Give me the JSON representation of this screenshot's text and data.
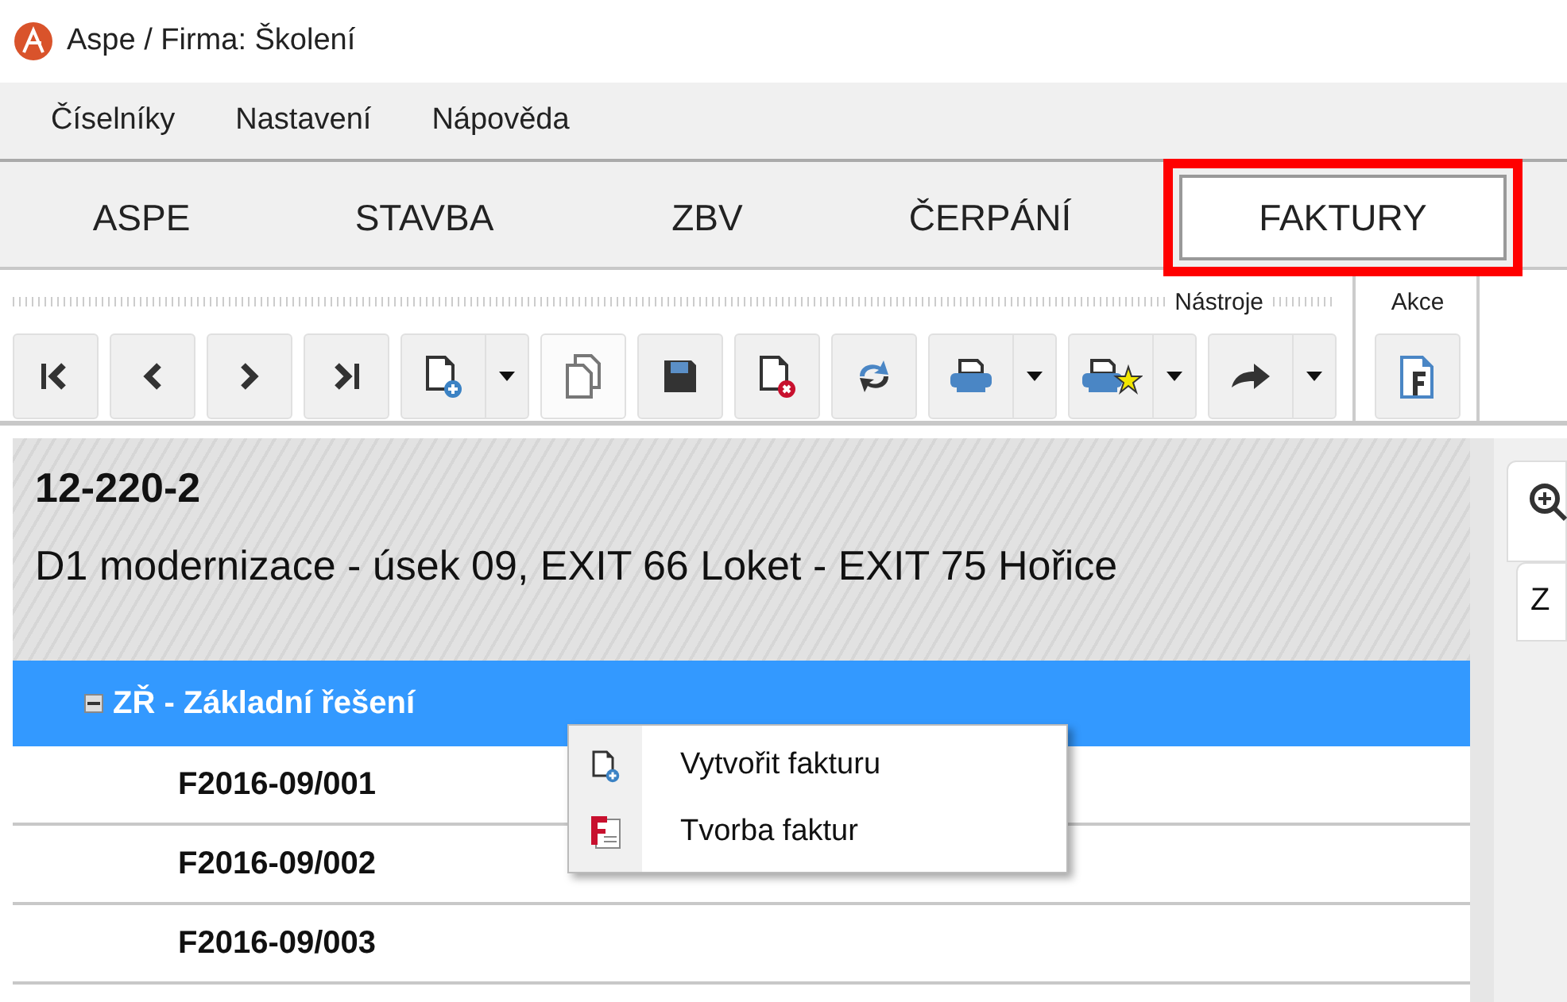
{
  "window": {
    "title": "Aspe / Firma: Školení"
  },
  "menu": [
    {
      "label": "Číselníky"
    },
    {
      "label": "Nastavení"
    },
    {
      "label": "Nápověda"
    }
  ],
  "tabs": [
    {
      "label": "ASPE",
      "selected": false,
      "highlighted": false
    },
    {
      "label": "STAVBA",
      "selected": false,
      "highlighted": false
    },
    {
      "label": "ZBV",
      "selected": false,
      "highlighted": false
    },
    {
      "label": "ČERPÁNÍ",
      "selected": false,
      "highlighted": false
    },
    {
      "label": "FAKTURY",
      "selected": true,
      "highlighted": true
    }
  ],
  "toolbar": [
    {
      "label": "Nástroje",
      "buttons": [
        {
          "kind": "first",
          "dropdown": false
        },
        {
          "kind": "prev",
          "dropdown": false
        },
        {
          "kind": "next",
          "dropdown": false
        },
        {
          "kind": "last",
          "dropdown": false
        },
        {
          "kind": "new",
          "dropdown": true
        },
        {
          "kind": "copy",
          "dropdown": false
        },
        {
          "kind": "save",
          "dropdown": false
        },
        {
          "kind": "delete",
          "dropdown": false
        },
        {
          "kind": "refresh",
          "dropdown": false
        },
        {
          "kind": "print",
          "dropdown": true
        },
        {
          "kind": "printfav",
          "dropdown": true
        },
        {
          "kind": "forward",
          "dropdown": true
        }
      ]
    },
    {
      "label": "Akce",
      "buttons": [
        {
          "kind": "invoice",
          "dropdown": false
        }
      ]
    }
  ],
  "record": {
    "code": "12-220-2",
    "name": "D1 modernizace - úsek 09, EXIT 66 Loket - EXIT 75 Hořice"
  },
  "tree": [
    {
      "label": "ZŘ - Základní řešení",
      "expanded": true,
      "selected": true,
      "children": [
        {
          "label": "F2016-09/001",
          "selected": false
        },
        {
          "label": "F2016-09/002",
          "selected": false
        },
        {
          "label": "F2016-09/003",
          "selected": false
        }
      ]
    }
  ],
  "context_menu": [
    {
      "kind": "new",
      "label": "Vytvořit fakturu"
    },
    {
      "kind": "invoices",
      "label": "Tvorba faktur"
    }
  ],
  "side_panel": {
    "tab": "Z"
  }
}
